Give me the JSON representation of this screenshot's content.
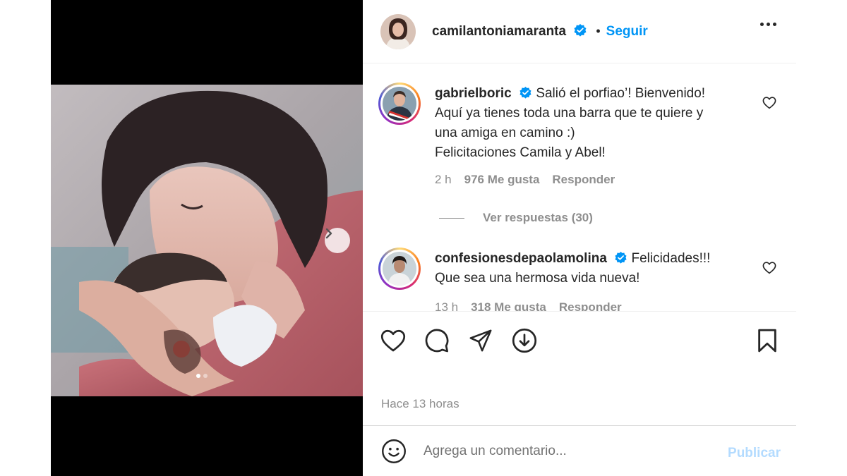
{
  "post": {
    "author": "camilantoniamaranta",
    "separator": "•",
    "follow_label": "Seguir",
    "time_ago": "Hace 13 horas"
  },
  "comments": [
    {
      "user": "gabrielboric",
      "lines": [
        "Salió el porfiao’! Bienvenido!",
        "Aquí ya tienes toda una barra que te quiere y",
        "una amiga en camino :)",
        "Felicitaciones Camila y Abel!"
      ],
      "time": "2 h",
      "likes": "976 Me gusta",
      "reply_label": "Responder",
      "view_replies": "Ver respuestas (30)"
    },
    {
      "user": "confesionesdepaolamolina",
      "lines": [
        "Felicidades!!!",
        "Que sea una hermosa vida nueva!"
      ],
      "time": "13 h",
      "likes": "318 Me gusta",
      "reply_label": "Responder"
    }
  ],
  "composer": {
    "placeholder": "Agrega un comentario...",
    "publish_label": "Publicar"
  },
  "carousel": {
    "current": 1,
    "total": 2
  },
  "colors": {
    "link_blue": "#0095f6",
    "publish_disabled": "#b3dbff",
    "muted_text": "#8e8e8e",
    "verified_blue": "#0095f6"
  },
  "icons": [
    "chevron-right-icon",
    "verified-icon",
    "more-icon",
    "heart-icon",
    "comment-icon",
    "share-icon",
    "save-icon",
    "bookmark-icon",
    "emoji-icon"
  ]
}
